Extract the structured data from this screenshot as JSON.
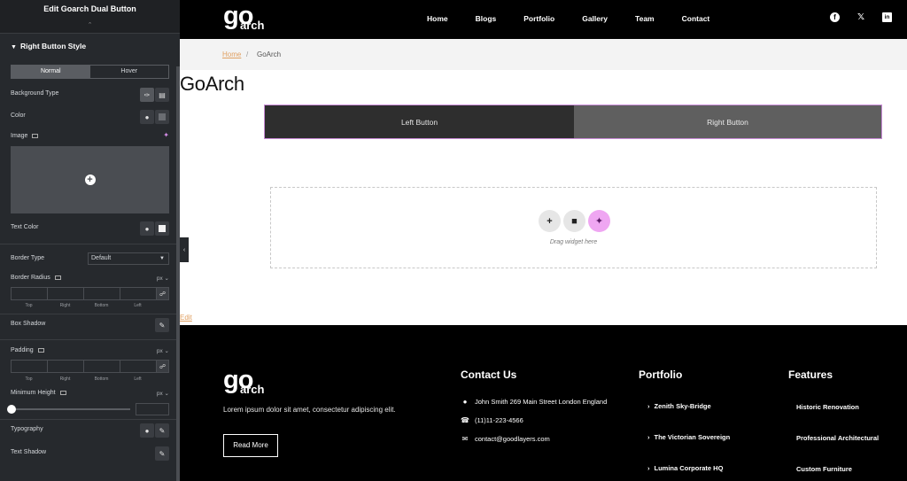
{
  "panel": {
    "title": "Edit Goarch Dual Button",
    "section": "Right Button Style",
    "tabs": [
      "Normal",
      "Hover"
    ],
    "background_type_label": "Background Type",
    "color_label": "Color",
    "image_label": "Image",
    "text_color_label": "Text Color",
    "border_type_label": "Border Type",
    "border_type_value": "Default",
    "border_radius_label": "Border Radius",
    "unit": "px",
    "dim_labels": [
      "Top",
      "Right",
      "Bottom",
      "Left"
    ],
    "box_shadow_label": "Box Shadow",
    "padding_label": "Padding",
    "min_height_label": "Minimum Height",
    "typography_label": "Typography",
    "text_shadow_label": "Text Shadow"
  },
  "site": {
    "logo_go": "go",
    "logo_arch": "arch",
    "nav": [
      "Home",
      "Blogs",
      "Portfolio",
      "Gallery",
      "Team",
      "Contact"
    ],
    "social": [
      "facebook-icon",
      "twitter-icon",
      "linkedin-icon"
    ],
    "breadcrumb": {
      "home": "Home",
      "separator": "/",
      "current": "GoArch"
    },
    "page_title": "GoArch",
    "dual_button": {
      "left": "Left Button",
      "right": "Right Button"
    },
    "dropzone_hint": "Drag widget here",
    "edit_link": "Edit"
  },
  "footer": {
    "about": "Lorem ipsum dolor sit amet, consectetur adipiscing elit.",
    "read_more": "Read More",
    "contact_title": "Contact Us",
    "contact": {
      "address": "John Smith 269 Main Street London England",
      "phone": "(11)11-223-4566",
      "email": "contact@goodlayers.com"
    },
    "portfolio_title": "Portfolio",
    "portfolio": [
      "Zenith Sky-Bridge",
      "The Victorian Sovereign",
      "Lumina Corporate HQ"
    ],
    "features_title": "Features",
    "features": [
      "Historic Renovation",
      "Professional Architectural",
      "Custom Furniture"
    ]
  }
}
